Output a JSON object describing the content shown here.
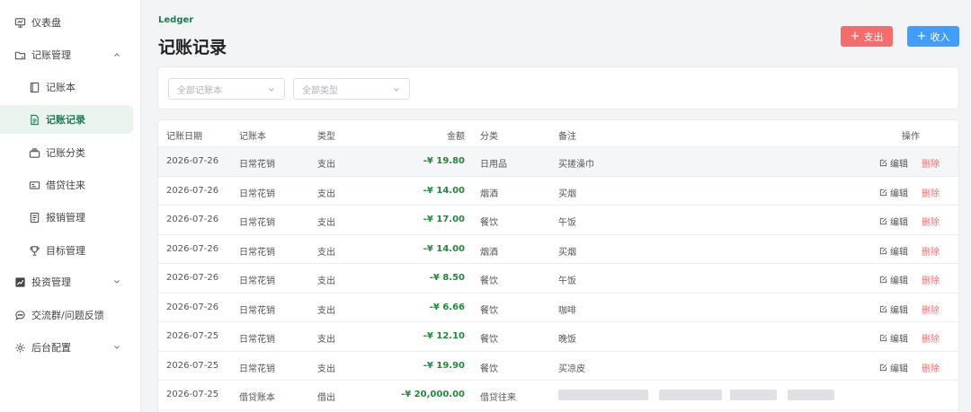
{
  "sidebar": {
    "items": [
      {
        "label": "仪表盘",
        "icon": "dashboard-icon"
      },
      {
        "label": "记账管理",
        "icon": "folder-icon",
        "expanded": true
      },
      {
        "label": "记账本",
        "icon": "book-icon"
      },
      {
        "label": "记账记录",
        "icon": "document-icon",
        "active": true
      },
      {
        "label": "记账分类",
        "icon": "category-icon"
      },
      {
        "label": "借贷往来",
        "icon": "card-icon"
      },
      {
        "label": "报销管理",
        "icon": "receipt-icon"
      },
      {
        "label": "目标管理",
        "icon": "trophy-icon"
      },
      {
        "label": "投资管理",
        "icon": "chart-icon"
      },
      {
        "label": "交流群/问题反馈",
        "icon": "chat-icon"
      },
      {
        "label": "后台配置",
        "icon": "gear-icon"
      }
    ]
  },
  "header": {
    "eyebrow": "Ledger",
    "title": "记账记录",
    "expense_label": "支出",
    "income_label": "收入"
  },
  "filters": {
    "book_placeholder": "全部记账本",
    "type_placeholder": "全部类型"
  },
  "table": {
    "columns": [
      "记账日期",
      "记账本",
      "类型",
      "金额",
      "分类",
      "备注",
      "操作"
    ],
    "edit_label": "编辑",
    "delete_label": "删除",
    "rows": [
      {
        "date": "2026-07-26",
        "book": "日常花销",
        "type": "支出",
        "amount": "-¥ 19.80",
        "category": "日用品",
        "note": "买搓澡巾"
      },
      {
        "date": "2026-07-26",
        "book": "日常花销",
        "type": "支出",
        "amount": "-¥ 14.00",
        "category": "烟酒",
        "note": "买烟"
      },
      {
        "date": "2026-07-26",
        "book": "日常花销",
        "type": "支出",
        "amount": "-¥ 17.00",
        "category": "餐饮",
        "note": "午饭"
      },
      {
        "date": "2026-07-26",
        "book": "日常花销",
        "type": "支出",
        "amount": "-¥ 14.00",
        "category": "烟酒",
        "note": "买烟"
      },
      {
        "date": "2026-07-26",
        "book": "日常花销",
        "type": "支出",
        "amount": "-¥ 8.50",
        "category": "餐饮",
        "note": "午饭"
      },
      {
        "date": "2026-07-26",
        "book": "日常花销",
        "type": "支出",
        "amount": "-¥ 6.66",
        "category": "餐饮",
        "note": "咖啡"
      },
      {
        "date": "2026-07-25",
        "book": "日常花销",
        "type": "支出",
        "amount": "-¥ 12.10",
        "category": "餐饮",
        "note": "晚饭"
      },
      {
        "date": "2026-07-25",
        "book": "日常花销",
        "type": "支出",
        "amount": "-¥ 19.90",
        "category": "餐饮",
        "note": "买凉皮"
      },
      {
        "date": "2026-07-25",
        "book": "借贷账本",
        "type": "借出",
        "amount": "-¥ 20,000.00",
        "category": "借贷往来",
        "note": ""
      }
    ]
  }
}
